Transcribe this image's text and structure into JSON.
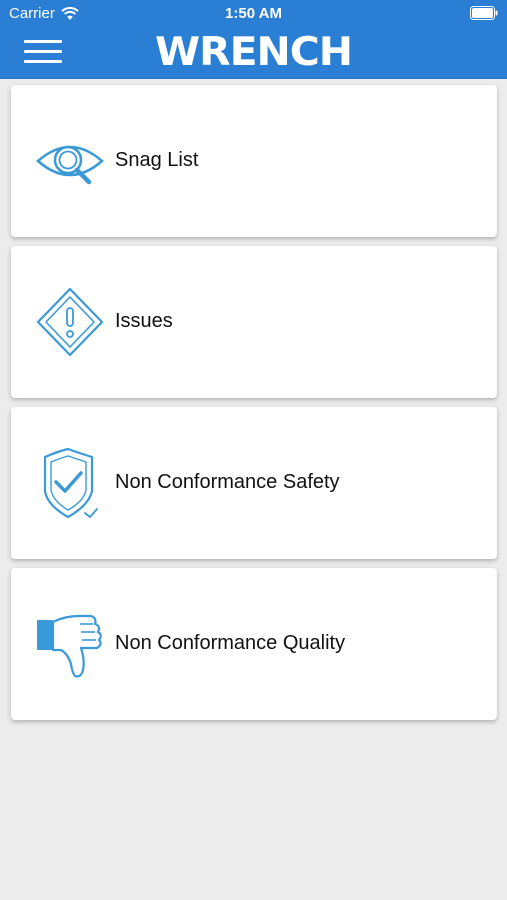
{
  "status_bar": {
    "carrier": "Carrier",
    "time": "1:50 AM"
  },
  "header": {
    "logo": "WRENCH",
    "menu_icon": "hamburger-menu-icon"
  },
  "colors": {
    "accent": "#2a7fd4",
    "icon": "#3a9ad9",
    "background": "#ececec"
  },
  "menu": {
    "items": [
      {
        "label": "Snag List",
        "icon": "eye-magnifier-icon"
      },
      {
        "label": "Issues",
        "icon": "warning-diamond-icon"
      },
      {
        "label": "Non Conformance Safety",
        "icon": "shield-check-icon"
      },
      {
        "label": "Non Conformance Quality",
        "icon": "thumbs-down-icon"
      }
    ]
  }
}
